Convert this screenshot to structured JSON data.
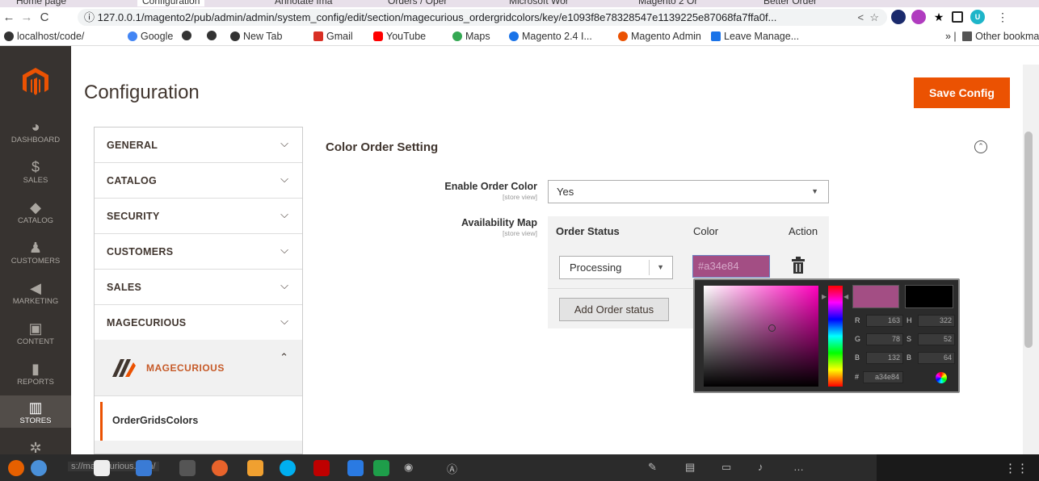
{
  "browser": {
    "tabs": [
      "Home page",
      "Configuration",
      "Annotate Ima",
      "Orders / Oper",
      "Microsoft Wor",
      "Magento 2 Or",
      "Better Order"
    ],
    "url": "127.0.0.1/magento2/pub/admin/admin/system_config/edit/section/magecurious_ordergridcolors/key/e1093f8e78328547e1139225e87068fa7ffa0f...",
    "bookmarks": [
      "localhost/code/",
      "Google",
      "New Tab",
      "Gmail",
      "YouTube",
      "Maps",
      "Magento 2.4 I...",
      "Magento Admin",
      "Leave Manage..."
    ],
    "other_bookmarks": "Other bookmarks",
    "profile_letter": "U"
  },
  "menu": {
    "items": [
      {
        "label": "DASHBOARD",
        "icon": "dashboard-icon"
      },
      {
        "label": "SALES",
        "icon": "dollar-icon"
      },
      {
        "label": "CATALOG",
        "icon": "box-icon"
      },
      {
        "label": "CUSTOMERS",
        "icon": "person-icon"
      },
      {
        "label": "MARKETING",
        "icon": "megaphone-icon"
      },
      {
        "label": "CONTENT",
        "icon": "content-icon"
      },
      {
        "label": "REPORTS",
        "icon": "bar-chart-icon"
      },
      {
        "label": "STORES",
        "icon": "store-icon"
      }
    ]
  },
  "page": {
    "title": "Configuration",
    "save_label": "Save Config"
  },
  "sections": [
    "GENERAL",
    "CATALOG",
    "SECURITY",
    "CUSTOMERS",
    "SALES",
    "MAGECURIOUS"
  ],
  "magecurious": {
    "brand_text": "MAGECURIOUS",
    "sub_item": "OrderGridsColors"
  },
  "settings": {
    "group_title": "Color Order Setting",
    "enable_label": "Enable Order Color",
    "enable_scope": "[store view]",
    "enable_value": "Yes",
    "map_label": "Availability Map",
    "map_scope": "[store view]",
    "columns": [
      "Order Status",
      "Color",
      "Action"
    ],
    "row_status": "Processing",
    "row_color": "#a34e84",
    "add_label": "Add Order status"
  },
  "picker": {
    "color": "#a34e84",
    "previous_color": "#000000",
    "r": "163",
    "g": "78",
    "b": "132",
    "h": "322",
    "s": "52",
    "br": "64",
    "hex": "a34e84"
  },
  "taskbar": {
    "status_text": "s://magecurious.com/"
  }
}
